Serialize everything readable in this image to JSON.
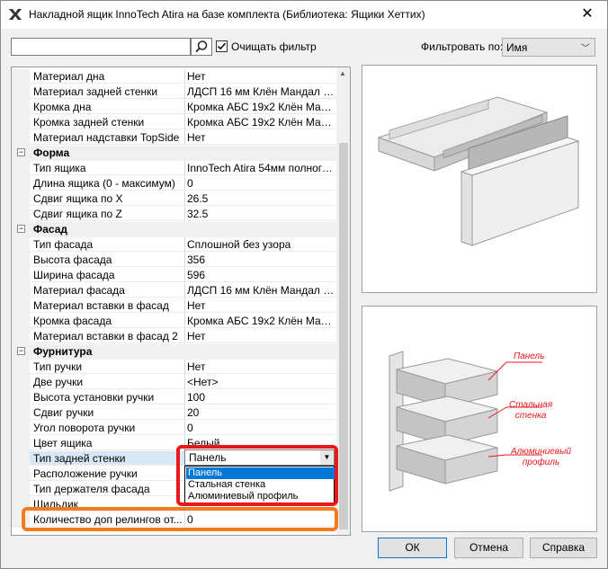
{
  "window": {
    "title": "Накладной ящик InnoTech Atira на базе комплекта (Библиотека: Ящики Хеттих)",
    "close_glyph": "✕"
  },
  "toolbar": {
    "search": {
      "value": "",
      "placeholder": ""
    },
    "clear_filter_label": "Очищать фильтр",
    "clear_filter_checked": true,
    "filter_by_label": "Фильтровать по:",
    "filter_by_value": "Имя"
  },
  "properties": {
    "rows": [
      {
        "name": "Материал дна",
        "value": "Нет"
      },
      {
        "name": "Материал задней стенки",
        "value": "ЛДСП 16 мм Клён Мандал на..."
      },
      {
        "name": "Кромка дна",
        "value": "Кромка АБС 19х2 Клён Манд..."
      },
      {
        "name": "Кромка задней стенки",
        "value": "Кромка АБС 19х2 Клён Манд..."
      },
      {
        "name": "Материал надставки TopSide",
        "value": "Нет"
      },
      {
        "category": "Форма"
      },
      {
        "name": "Тип ящика",
        "value": "InnoTech Atira 54мм полного ..."
      },
      {
        "name": "Длина ящика (0 - максимум)",
        "value": "0"
      },
      {
        "name": "Сдвиг ящика по X",
        "value": "26.5"
      },
      {
        "name": "Сдвиг ящика по Z",
        "value": "32.5"
      },
      {
        "category": "Фасад"
      },
      {
        "name": "Тип фасада",
        "value": "Сплошной без узора"
      },
      {
        "name": "Высота фасада",
        "value": "356"
      },
      {
        "name": "Ширина фасада",
        "value": "596"
      },
      {
        "name": "Материал фасада",
        "value": "ЛДСП 16 мм Клён Мандал на..."
      },
      {
        "name": "Материал вставки в фасад",
        "value": "Нет"
      },
      {
        "name": "Кромка фасада",
        "value": "Кромка АБС 19х2 Клён Манд..."
      },
      {
        "name": "Материал вставки в фасад 2",
        "value": "Нет"
      },
      {
        "category": "Фурнитура"
      },
      {
        "name": "Тип ручки",
        "value": "Нет"
      },
      {
        "name": "Две ручки",
        "value": "<Нет>"
      },
      {
        "name": "Высота установки ручки",
        "value": "100"
      },
      {
        "name": "Сдвиг ручки",
        "value": "20"
      },
      {
        "name": "Угол поворота ручки",
        "value": "0"
      },
      {
        "name": "Цвет ящика",
        "value": "Белый"
      },
      {
        "name": "Тип задней стенки",
        "value": "",
        "selected": true
      },
      {
        "name": "Расположение ручки",
        "value": ""
      },
      {
        "name": "Тип держателя фасада",
        "value": ""
      },
      {
        "name": "Шильдик",
        "value": ""
      },
      {
        "name": "Количество доп релингов от...",
        "value": "0"
      }
    ]
  },
  "back_wall_dropdown": {
    "value": "Панель",
    "options": [
      "Панель",
      "Стальная стенка",
      "Алюминиевый профиль"
    ],
    "highlighted_index": 0
  },
  "diagram_callouts": {
    "panel": "Панель",
    "steel": "Стальная\nстенка",
    "alu": "Алюминиевый\nпрофиль"
  },
  "buttons": {
    "ok": "ОК",
    "cancel": "Отмена",
    "help": "Справка"
  },
  "colors": {
    "highlight_red": "#e8181b",
    "highlight_orange": "#f47b20",
    "selection": "#0078d7"
  }
}
